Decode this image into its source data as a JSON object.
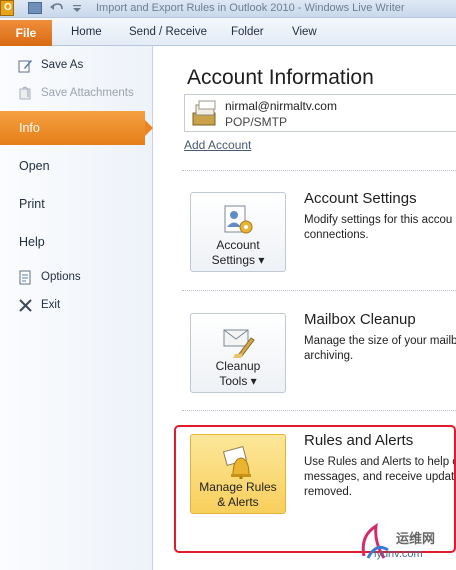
{
  "window": {
    "title": "Import and Export Rules in Outlook 2010 - Windows Live Writer",
    "app_icon_letter": "O"
  },
  "ribbon": {
    "tabs": [
      "File",
      "Home",
      "Send / Receive",
      "Folder",
      "View"
    ]
  },
  "backstage_nav": {
    "commands_top": [
      {
        "label": "Save As",
        "icon": "save-as-icon",
        "enabled": true
      },
      {
        "label": "Save Attachments",
        "icon": "save-attachments-icon",
        "enabled": false
      }
    ],
    "tabs": [
      {
        "label": "Info",
        "active": true
      },
      {
        "label": "Open",
        "active": false
      },
      {
        "label": "Print",
        "active": false
      },
      {
        "label": "Help",
        "active": false
      }
    ],
    "commands_bottom": [
      {
        "label": "Options",
        "icon": "options-icon"
      },
      {
        "label": "Exit",
        "icon": "exit-icon"
      }
    ]
  },
  "account_info": {
    "title": "Account Information",
    "account": {
      "email": "nirmal@nirmaltv.com",
      "type": "POP/SMTP"
    },
    "add_account": "Add Account"
  },
  "sections": [
    {
      "button_label_1": "Account",
      "button_label_2": "Settings ▾",
      "title": "Account Settings",
      "desc_1": "Modify settings for this accou",
      "desc_2": "connections.",
      "desc_3": ""
    },
    {
      "button_label_1": "Cleanup",
      "button_label_2": "Tools ▾",
      "title": "Mailbox Cleanup",
      "desc_1": "Manage the size of your mailb",
      "desc_2": "archiving.",
      "desc_3": ""
    },
    {
      "button_label_1": "Manage Rules",
      "button_label_2": "& Alerts",
      "title": "Rules and Alerts",
      "desc_1": "Use Rules and Alerts to help o",
      "desc_2": "messages, and receive updat",
      "desc_3": "removed."
    }
  ],
  "watermark": {
    "top": "运维网",
    "bottom": "iyunv.com"
  },
  "colors": {
    "file_tab": "#d86a12",
    "active_nav": "#e57e17",
    "highlight_box": "#e21b2a",
    "link": "#475a74"
  }
}
